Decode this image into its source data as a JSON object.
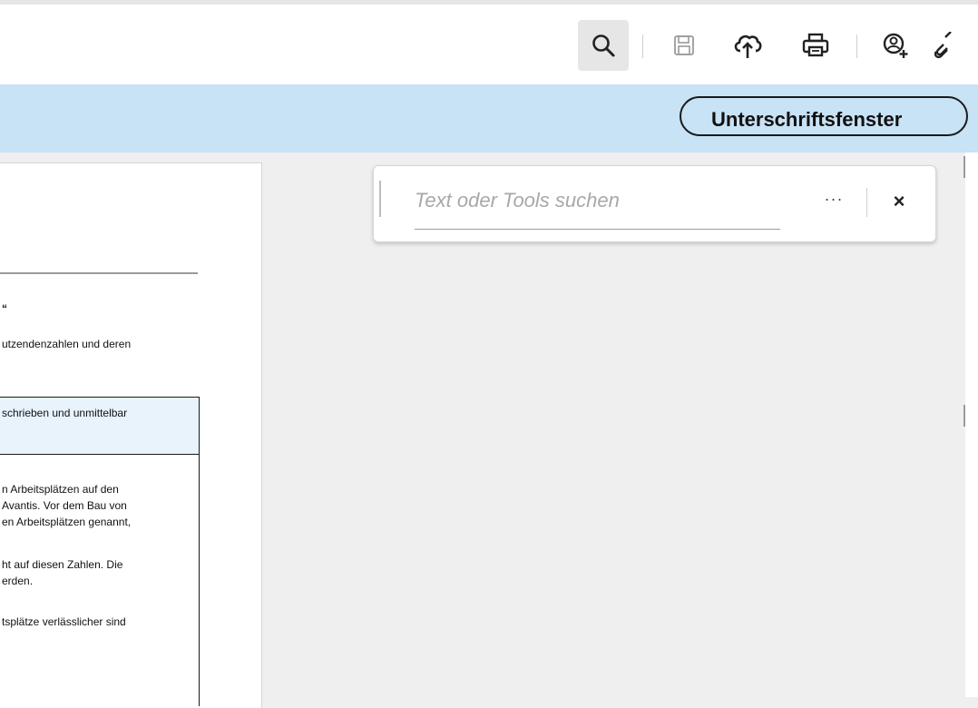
{
  "toolbar": {
    "icons": {
      "search": "search-icon",
      "save": "save-icon",
      "upload": "cloud-upload-icon",
      "print": "printer-icon",
      "add_user": "add-person-icon",
      "link": "link-icon"
    }
  },
  "ribbon": {
    "signature_button_label": "Unterschriftsfenster"
  },
  "search_panel": {
    "placeholder": "Text oder Tools suchen",
    "more_label": "···",
    "close_label": "×"
  },
  "document": {
    "heading_fragment": "“",
    "line_1": "utzendenzahlen und deren",
    "box_header": "schrieben und unmittelbar",
    "paragraph_1": [
      "n Arbeitsplätzen auf den",
      "Avantis. Vor dem Bau von",
      "en Arbeitsplätzen genannt,"
    ],
    "paragraph_2": [
      "ht auf diesen Zahlen. Die",
      "erden."
    ],
    "paragraph_3": "tsplätze verlässlicher sind"
  },
  "colors": {
    "ribbon_bg": "#c8e2f6",
    "toolbar_bg": "#ffffff",
    "workspace_bg": "#efefef"
  }
}
